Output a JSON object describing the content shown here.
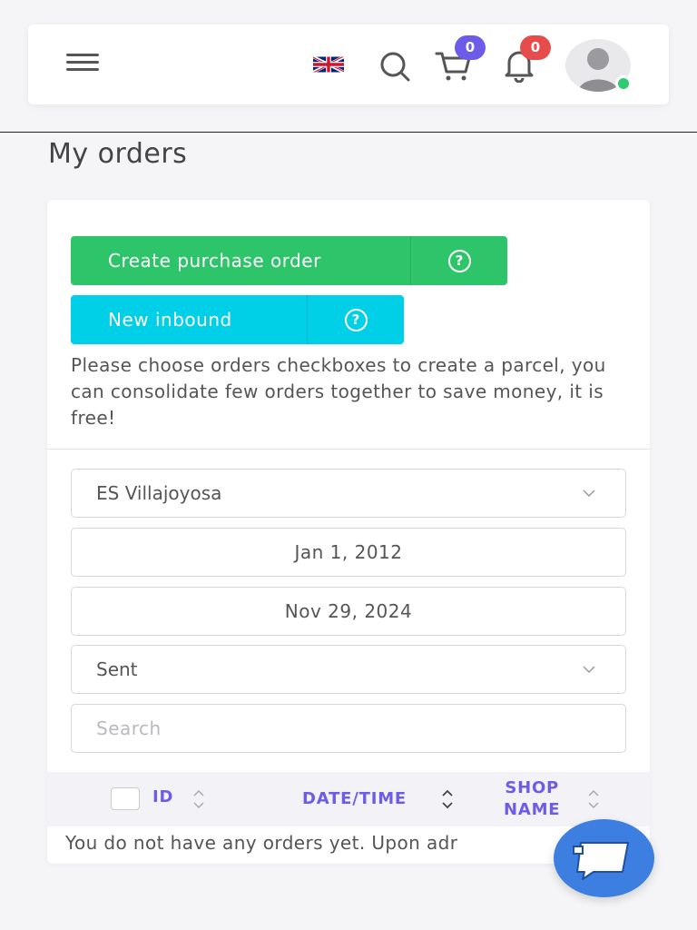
{
  "header": {
    "cart_count": "0",
    "notifications_count": "0"
  },
  "page": {
    "title": "My orders"
  },
  "actions": {
    "create_purchase_order": "Create purchase order",
    "new_inbound": "New inbound",
    "help_symbol": "?"
  },
  "info_text": "Please choose orders checkboxes to create a parcel, you can consolidate few orders together to save money, it is free!",
  "filters": {
    "warehouse": "ES Villajoyosa",
    "date_from": "Jan 1, 2012",
    "date_to": "Nov 29, 2024",
    "status": "Sent",
    "search_placeholder": "Search"
  },
  "table": {
    "col_id": "ID",
    "col_datetime": "DATE/TIME",
    "col_shop_line1": "SHOP",
    "col_shop_line2": "NAME"
  },
  "empty_message": "You do not have any orders yet. Upon adr",
  "colors": {
    "accent": "#6c5ce7",
    "green": "#2ec46a",
    "cyan": "#00cfe8",
    "badge_red": "#e74c4c",
    "chat_blue": "#3d7fe0",
    "online": "#2ecc71"
  },
  "icons": [
    "menu-icon",
    "uk-flag-icon",
    "search-icon",
    "cart-icon",
    "bell-icon",
    "user-avatar",
    "help-icon",
    "chevron-down-icon",
    "sort-icon",
    "chat-icon"
  ]
}
